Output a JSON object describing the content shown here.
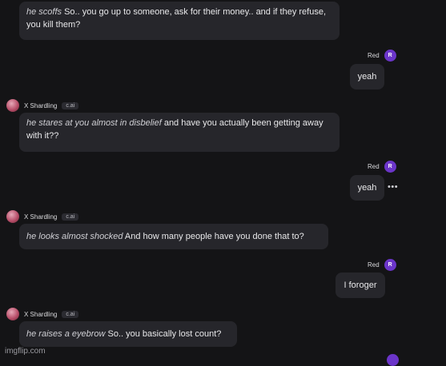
{
  "messages": [
    {
      "action": "he scoffs",
      "text": " So.. you go up to someone, ask for their money.. and if they refuse, you kill them?"
    },
    {
      "sender": "Red",
      "avatar": "R",
      "text": "yeah"
    },
    {
      "sender": "X Shardling",
      "badge": "c.ai",
      "action": "he stares at you almost in disbelief",
      "text": " and have you actually been getting away with it??"
    },
    {
      "sender": "Red",
      "avatar": "R",
      "text": "yeah"
    },
    {
      "sender": "X Shardling",
      "badge": "c.ai",
      "action": "he looks almost shocked",
      "text": " And how many people have you done that to?"
    },
    {
      "sender": "Red",
      "avatar": "R",
      "text": "I foroger"
    },
    {
      "sender": "X Shardling",
      "badge": "c.ai",
      "action": "he raises a eyebrow",
      "text": " So.. you basically lost count?"
    }
  ],
  "watermark": "imgflip.com",
  "colors": {
    "background": "#141416",
    "bubble": "#26262b",
    "user_avatar": "#6b35c9"
  }
}
